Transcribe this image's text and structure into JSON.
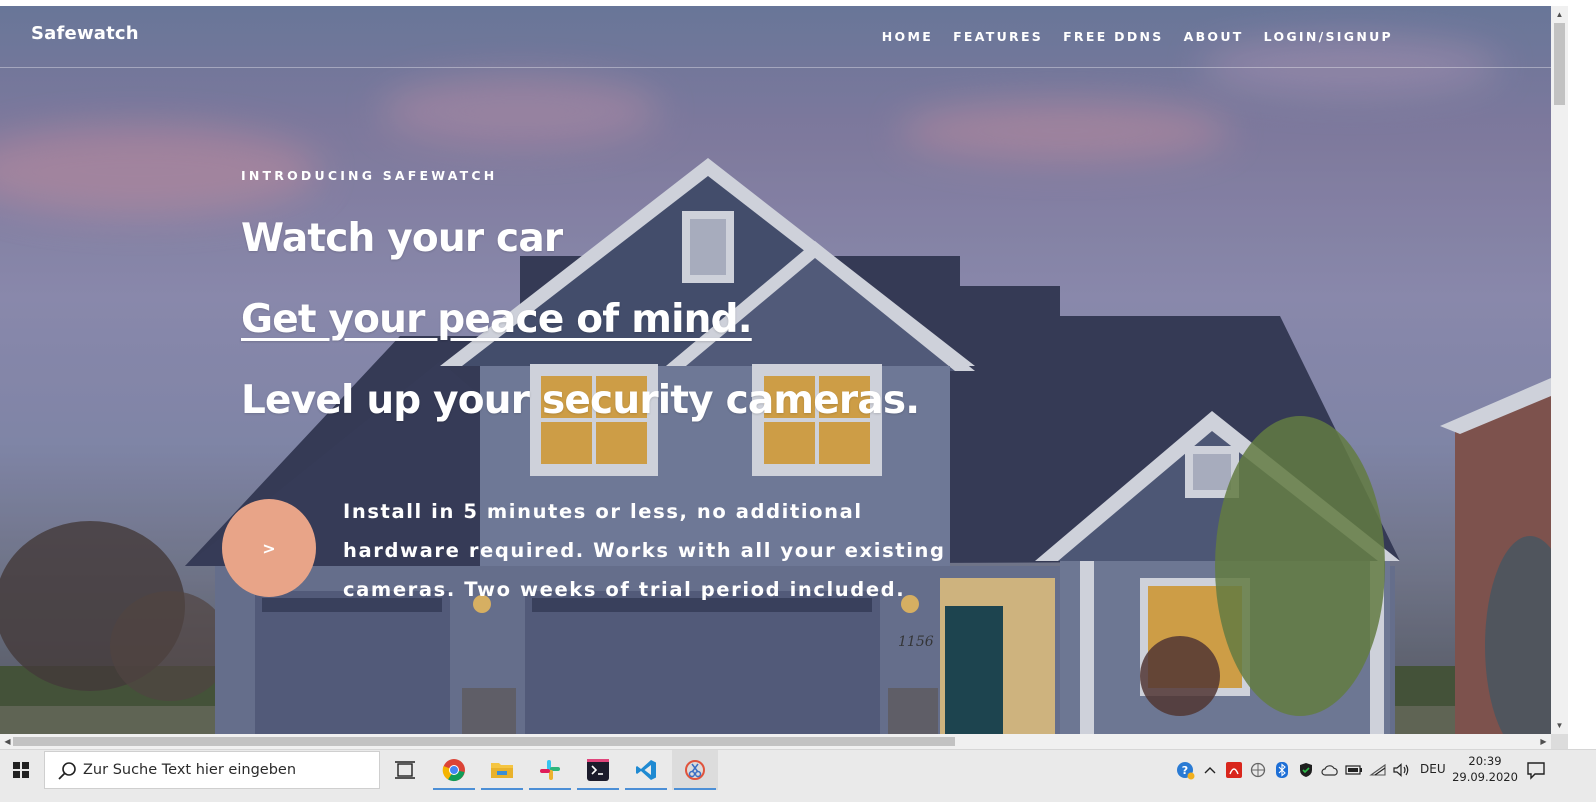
{
  "nav": {
    "brand": "Safewatch",
    "links": [
      "HOME",
      "FEATURES",
      "FREE DDNS",
      "ABOUT",
      "LOGIN/SIGNUP"
    ]
  },
  "hero": {
    "eyebrow": "INTRODUCING SAFEWATCH",
    "headline_1": "Watch your car",
    "headline_2": "Get your peace of mind.",
    "headline_3": "Level up your security cameras.",
    "cta_label": ">",
    "description": "Install in 5 minutes or less, no additional hardware required. Works with all your existing cameras. Two weeks of trial period included.",
    "house_number": "1156",
    "cta_color": "#e8a488"
  },
  "taskbar": {
    "search_placeholder": "Zur Suche Text hier eingeben",
    "apps": [
      "task-view",
      "chrome",
      "file-explorer",
      "slack",
      "terminal",
      "vscode",
      "snipping-tool"
    ],
    "language": "DEU",
    "time": "20:39",
    "date": "29.09.2020"
  }
}
